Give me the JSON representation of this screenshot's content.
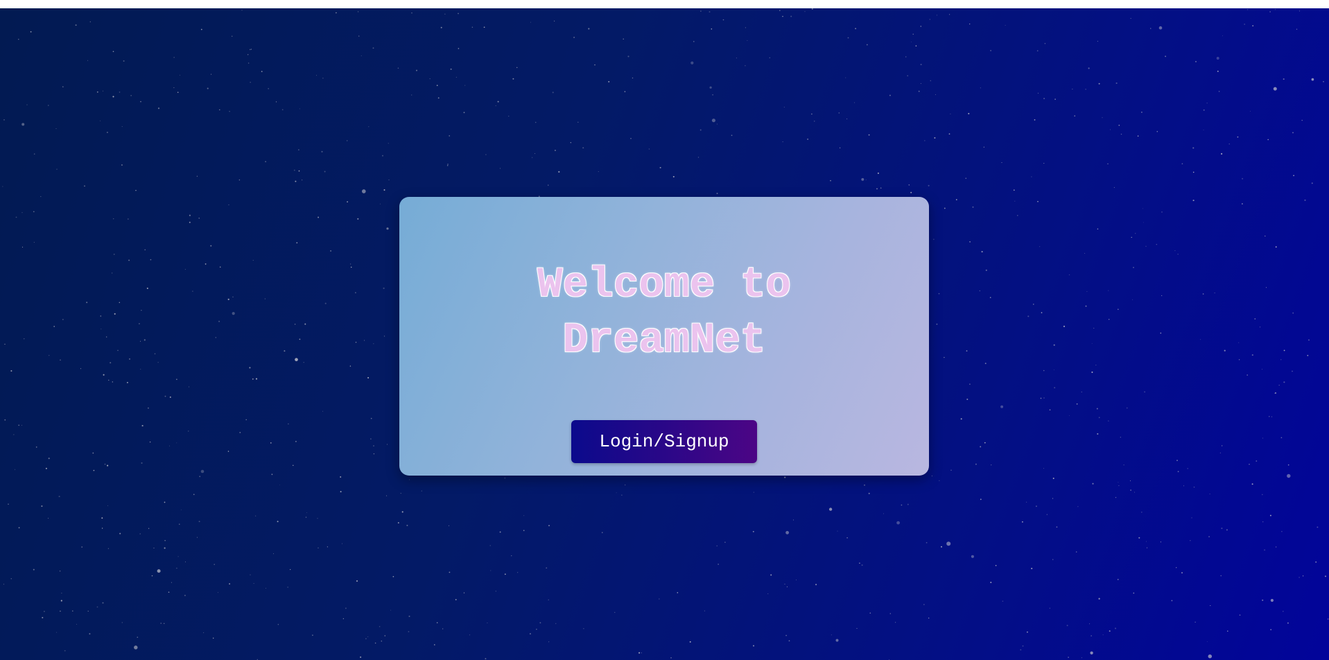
{
  "hero": {
    "title_line1": "Welcome to",
    "title_line2": "DreamNet"
  },
  "actions": {
    "login_signup_label": "Login/Signup"
  },
  "colors": {
    "background_start": "#021a52",
    "background_end": "#02049a",
    "card_start": "#76acd6",
    "card_end": "#b9b7e0",
    "title_fill": "#ebc3ee",
    "button_start": "#0b0a8c",
    "button_end": "#4c0585"
  }
}
